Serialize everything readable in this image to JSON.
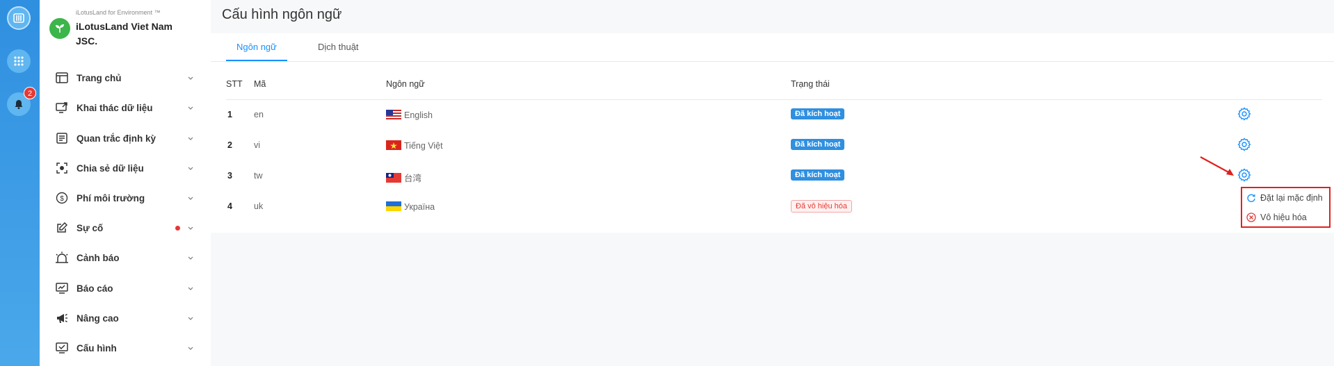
{
  "rail": {
    "notification_count": "2"
  },
  "brand": {
    "subtitle": "iLotusLand for Environment ™",
    "name": "iLotusLand Viet Nam JSC."
  },
  "sidebar": {
    "items": [
      {
        "label": "Trang chủ"
      },
      {
        "label": "Khai thác dữ liệu"
      },
      {
        "label": "Quan trắc định kỳ"
      },
      {
        "label": "Chia sẻ dữ liệu"
      },
      {
        "label": "Phí môi trường"
      },
      {
        "label": "Sự cố"
      },
      {
        "label": "Cảnh báo"
      },
      {
        "label": "Báo cáo"
      },
      {
        "label": "Nâng cao"
      },
      {
        "label": "Cấu hình"
      }
    ]
  },
  "page": {
    "title": "Cấu hình ngôn ngữ"
  },
  "tabs": [
    {
      "label": "Ngôn ngữ"
    },
    {
      "label": "Dịch thuật"
    }
  ],
  "table": {
    "headers": {
      "stt": "STT",
      "code": "Mã",
      "language": "Ngôn ngữ",
      "status": "Trạng thái"
    },
    "rows": [
      {
        "stt": "1",
        "code": "en",
        "language": "English",
        "flag": "us-flag",
        "status": "Đã kích hoạt"
      },
      {
        "stt": "2",
        "code": "vi",
        "language": "Tiếng Việt",
        "flag": "vn-flag",
        "status": "Đã kích hoạt"
      },
      {
        "stt": "3",
        "code": "tw",
        "language": "台湾",
        "flag": "tw-flag",
        "status": "Đã kích hoạt"
      },
      {
        "stt": "4",
        "code": "uk",
        "language": "Україна",
        "flag": "ua-flag",
        "status": "Đã vô hiệu hóa"
      }
    ]
  },
  "dropdown": {
    "reset_label": "Đặt lại mặc định",
    "disable_label": "Vô hiệu hóa"
  },
  "colors": {
    "accent": "#1890ff",
    "rail": "#2f8fe0",
    "active_tag": "#2f8fe0",
    "danger": "#e53935"
  }
}
